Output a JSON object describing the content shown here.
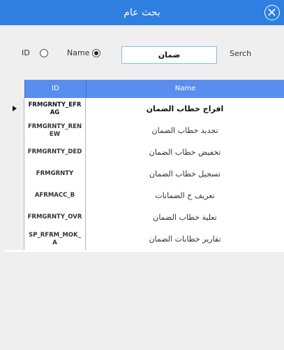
{
  "window": {
    "title": "بحث عام",
    "close_icon": "close-circle-icon",
    "accent_color": "#2e7fe0"
  },
  "search": {
    "option_id_label": "ID",
    "option_name_label": "Name",
    "selected_option": "Name",
    "value": "ضمان",
    "button_label": "Serch"
  },
  "grid": {
    "columns": [
      "ID",
      "Name"
    ],
    "header_color": "#5a8df0",
    "selected_row": 0,
    "rows": [
      {
        "id": "FRMGRNTY_EFRAG",
        "name": "افراج خطاب الضمان"
      },
      {
        "id": "FRMGRNTY_RENEW",
        "name": "تجديد خطاب الضمان"
      },
      {
        "id": "FRMGRNTY_DED",
        "name": "تخفيض خطاب الضمان"
      },
      {
        "id": "FRMGRNTY",
        "name": "تسجيل خطاب الضمان"
      },
      {
        "id": "AFRMACC_B",
        "name": "تعريف ح الضمانات"
      },
      {
        "id": "FRMGRNTY_OVR",
        "name": "تعلية خطاب الضمان"
      },
      {
        "id": "SP_RFRM_MOK_A",
        "name": "تقارير خطابات الضمان"
      }
    ]
  }
}
